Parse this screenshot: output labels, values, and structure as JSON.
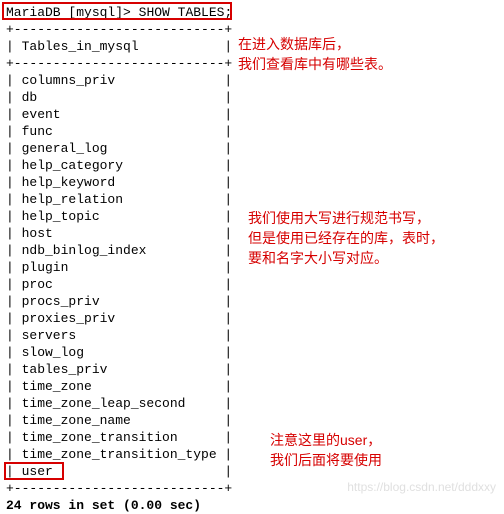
{
  "prompt": {
    "shell": "MariaDB [mysql]>",
    "command": "SHOW TABLES;"
  },
  "divider": "+---------------------------+",
  "header": "| Tables_in_mysql           |",
  "tables": [
    "columns_priv",
    "db",
    "event",
    "func",
    "general_log",
    "help_category",
    "help_keyword",
    "help_relation",
    "help_topic",
    "host",
    "ndb_binlog_index",
    "plugin",
    "proc",
    "procs_priv",
    "proxies_priv",
    "servers",
    "slow_log",
    "tables_priv",
    "time_zone",
    "time_zone_leap_second",
    "time_zone_name",
    "time_zone_transition",
    "time_zone_transition_type",
    "user"
  ],
  "result": "24 rows in set (0.00 sec)",
  "annotations": {
    "top1": "在进入数据库后，",
    "top2": "我们查看库中有哪些表。",
    "mid1": "我们使用大写进行规范书写，",
    "mid2": "但是使用已经存在的库，表时，",
    "mid3": "要和名字大小写对应。",
    "bot1": "注意这里的user，",
    "bot2": "我们后面将要使用"
  },
  "watermark": "https://blog.csdn.net/dddxxy"
}
